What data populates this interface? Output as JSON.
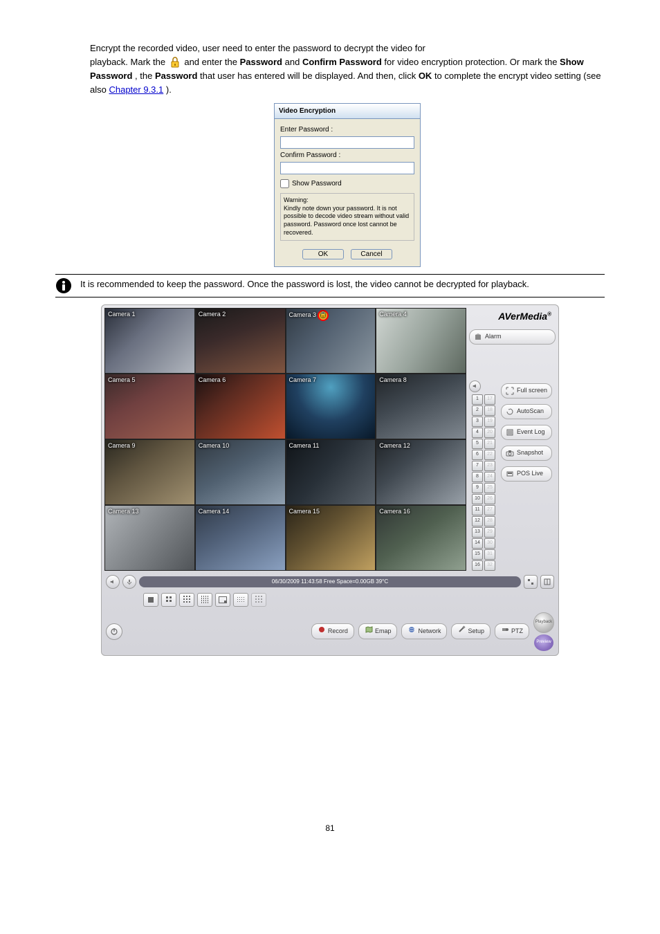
{
  "intro": {
    "encrypt_line": "Encrypt the recorded video, user need to enter the password to decrypt the video for",
    "playback_line": "playback. Mark the ",
    "playback_rest": " and enter the ",
    "password_word": "Password",
    "confirm_word": "Confirm Password",
    "protection_rest": " for video encryption protection. Or mark the ",
    "show_pw": "Show Password",
    "display_rest": " that user has entered will be displayed. And then, click ",
    "ok_word": "OK",
    "complete_rest": " to complete the encrypt video setting (see also ",
    "chapter_ref": "Chapter 9.3.1"
  },
  "dialog": {
    "title": "Video Encryption",
    "enter_pw": "Enter Password :",
    "confirm_pw": "Confirm Password :",
    "show_pw": "Show Password",
    "warning_head": "Warning:",
    "warning_body": "Kindly note down your password. It is not possible to decode video stream without valid password. Password once lost cannot be recovered.",
    "ok": "OK",
    "cancel": "Cancel"
  },
  "info_note": "It is recommended to keep the password. Once the password is lost, the video cannot be decrypted for playback.",
  "screenshot": {
    "brand": "AVerMedia",
    "brand_r": "®",
    "cameras": [
      "Camera 1",
      "Camera 2",
      "Camera 3",
      "Camera 4",
      "Camera 5",
      "Camera 6",
      "Camera 7",
      "Camera 8",
      "Camera 9",
      "Camera 10",
      "Camera 11",
      "Camera 12",
      "Camera 13",
      "Camera 14",
      "Camera 15",
      "Camera 16"
    ],
    "side_buttons": {
      "alarm": "Alarm",
      "fullscreen": "Full screen",
      "autoscan": "AutoScan",
      "eventlog": "Event Log",
      "snapshot": "Snapshot",
      "poslive": "POS Live"
    },
    "status": "06/30/2009 11:43:58  Free Space=0.00GB 39°C",
    "footer": {
      "record": "Record",
      "emap": "Emap",
      "network": "Network",
      "setup": "Setup",
      "ptz": "PTZ",
      "playback": "Playback",
      "preview": "Preview"
    },
    "cam_numbers_col1": [
      1,
      2,
      3,
      4,
      5,
      6,
      7,
      8,
      9,
      10,
      11,
      12,
      13,
      14,
      15,
      16
    ],
    "cam_numbers_col2": [
      17,
      18,
      19,
      20,
      21,
      22,
      23,
      24,
      25,
      26,
      27,
      28,
      29,
      30,
      31,
      32
    ]
  },
  "page_number": "81"
}
